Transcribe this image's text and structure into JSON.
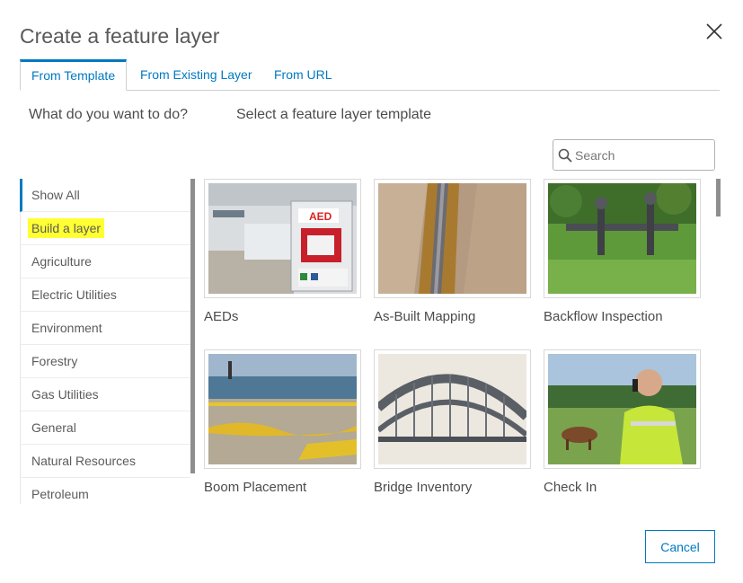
{
  "dialog": {
    "title": "Create a feature layer",
    "close_icon": "close-icon"
  },
  "tabs": [
    {
      "label": "From Template",
      "active": true
    },
    {
      "label": "From Existing Layer",
      "active": false
    },
    {
      "label": "From URL",
      "active": false
    }
  ],
  "question": "What do you want to do?",
  "subtitle": "Select a feature layer template",
  "search": {
    "placeholder": "Search",
    "icon": "search-icon",
    "value": ""
  },
  "categories": [
    {
      "label": "Show All",
      "active": true
    },
    {
      "label": "Build a layer",
      "highlighted": true
    },
    {
      "label": "Agriculture"
    },
    {
      "label": "Electric Utilities"
    },
    {
      "label": "Environment"
    },
    {
      "label": "Forestry"
    },
    {
      "label": "Gas Utilities"
    },
    {
      "label": "General"
    },
    {
      "label": "Natural Resources"
    },
    {
      "label": "Petroleum"
    }
  ],
  "templates": [
    {
      "label": "AEDs",
      "image": "aed-station-photo"
    },
    {
      "label": "As-Built Mapping",
      "image": "pipe-trench-photo"
    },
    {
      "label": "Backflow Inspection",
      "image": "backflow-valve-photo"
    },
    {
      "label": "Boom Placement",
      "image": "oil-boom-beach-photo"
    },
    {
      "label": "Bridge Inventory",
      "image": "arch-bridge-photo"
    },
    {
      "label": "Check In",
      "image": "worker-phone-field-photo"
    }
  ],
  "footer": {
    "cancel_label": "Cancel"
  },
  "colors": {
    "accent": "#0079c1",
    "highlight": "#ffff33"
  }
}
